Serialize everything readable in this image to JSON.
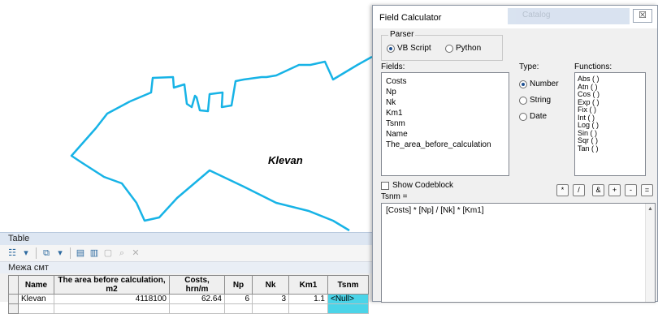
{
  "map": {
    "label": "Klevan"
  },
  "table": {
    "title": "Table",
    "tab_label": "Межа смт",
    "columns": [
      "Name",
      "The area before calculation, m2",
      "Costs, hrn/m",
      "Np",
      "Nk",
      "Km1",
      "Tsnm"
    ],
    "row": {
      "name": "Klevan",
      "area": "4118100",
      "costs": "62.64",
      "np": "6",
      "nk": "3",
      "km1": "1.1",
      "tsnm": "<Null>"
    }
  },
  "dialog": {
    "title": "Field Calculator",
    "background_title": "Catalog",
    "close_glyph": "☒",
    "parser_label": "Parser",
    "parser_vb": "VB Script",
    "parser_python": "Python",
    "fields_label": "Fields:",
    "fields": [
      "Costs",
      "Np",
      "Nk",
      "Km1",
      "Tsnm",
      "Name",
      "The_area_before_calculation"
    ],
    "type_label": "Type:",
    "type_number": "Number",
    "type_string": "String",
    "type_date": "Date",
    "functions_label": "Functions:",
    "functions": [
      "Abs ( )",
      "Atn ( )",
      "Cos ( )",
      "Exp ( )",
      "Fix ( )",
      "Int ( )",
      "Log ( )",
      "Sin ( )",
      "Sqr ( )",
      "Tan ( )"
    ],
    "show_codeblock": "Show Codeblock",
    "expression_label": "Tsnm =",
    "expression": "[Costs] * [Np] / [Nk] * [Km1]",
    "operators": [
      "*",
      "/",
      "&",
      "+",
      "-",
      "="
    ]
  },
  "colors": {
    "boundary": "#17b3e6",
    "selected_cell": "#4bd4e8"
  }
}
